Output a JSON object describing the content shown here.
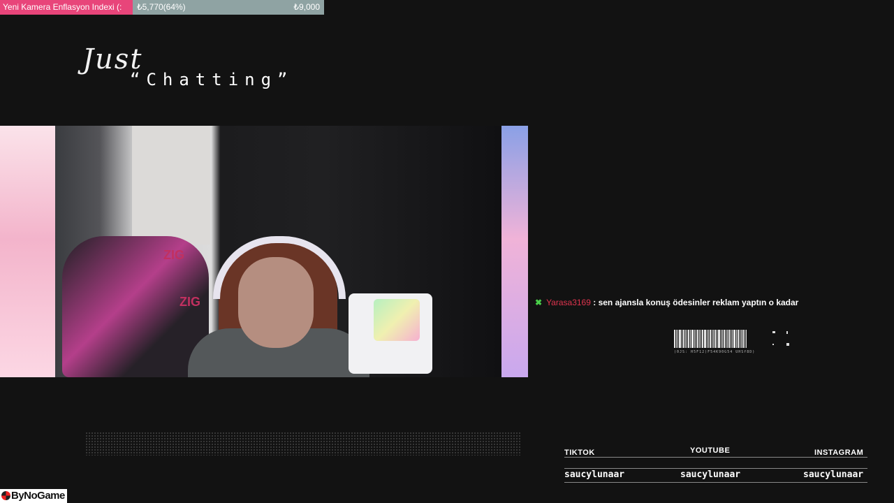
{
  "goal": {
    "title": "Yeni Kamera Enflasyon Indexi (:",
    "current": "₺5,770(64%)",
    "target": "₺9,000",
    "progress_fraction": 0.64,
    "fill_color": "#e8457a",
    "track_color": "#8fa3a3"
  },
  "stream_title": {
    "script": "Just",
    "sub": "“Chatting”"
  },
  "camera": {
    "chair_brand": "ZIG"
  },
  "chat": {
    "icon": "sword-icon",
    "user": "Yarasa3169",
    "separator": " : ",
    "message": "sen ajansla konuş ödesinler reklam yaptın o kadar",
    "user_color": "#e0344e"
  },
  "barcode": {
    "caption": "(0JS: H5F12)F54K90G54 UHSf8D)"
  },
  "socials": [
    {
      "platform": "TIKTOK",
      "handle": "saucylunaar"
    },
    {
      "platform": "YOUTUBE",
      "handle": "saucylunaar"
    },
    {
      "platform": "INSTAGRAM",
      "handle": "saucylunaar"
    }
  ],
  "watermark": {
    "text": "ByNoGame"
  }
}
